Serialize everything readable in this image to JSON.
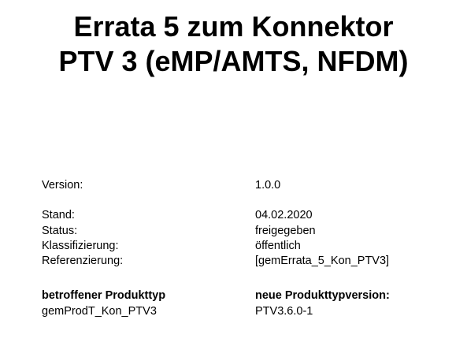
{
  "title": {
    "line1": "Errata 5 zum Konnektor",
    "line2": "PTV 3 (eMP/AMTS, NFDM)"
  },
  "fields": {
    "version": {
      "label": "Version:",
      "value": "1.0.0"
    },
    "stand": {
      "label": "Stand:",
      "value": "04.02.2020"
    },
    "status": {
      "label": "Status:",
      "value": "freigegeben"
    },
    "klassifizierung": {
      "label": "Klassifizierung:",
      "value": "öffentlich"
    },
    "referenzierung": {
      "label": "Referenzierung:",
      "value": "[gemErrata_5_Kon_PTV3]"
    }
  },
  "product": {
    "type_header": "betroffener Produkttyp",
    "version_header": "neue Produkttypversion:",
    "type_value": "gemProdT_Kon_PTV3",
    "version_value": "PTV3.6.0-1"
  }
}
